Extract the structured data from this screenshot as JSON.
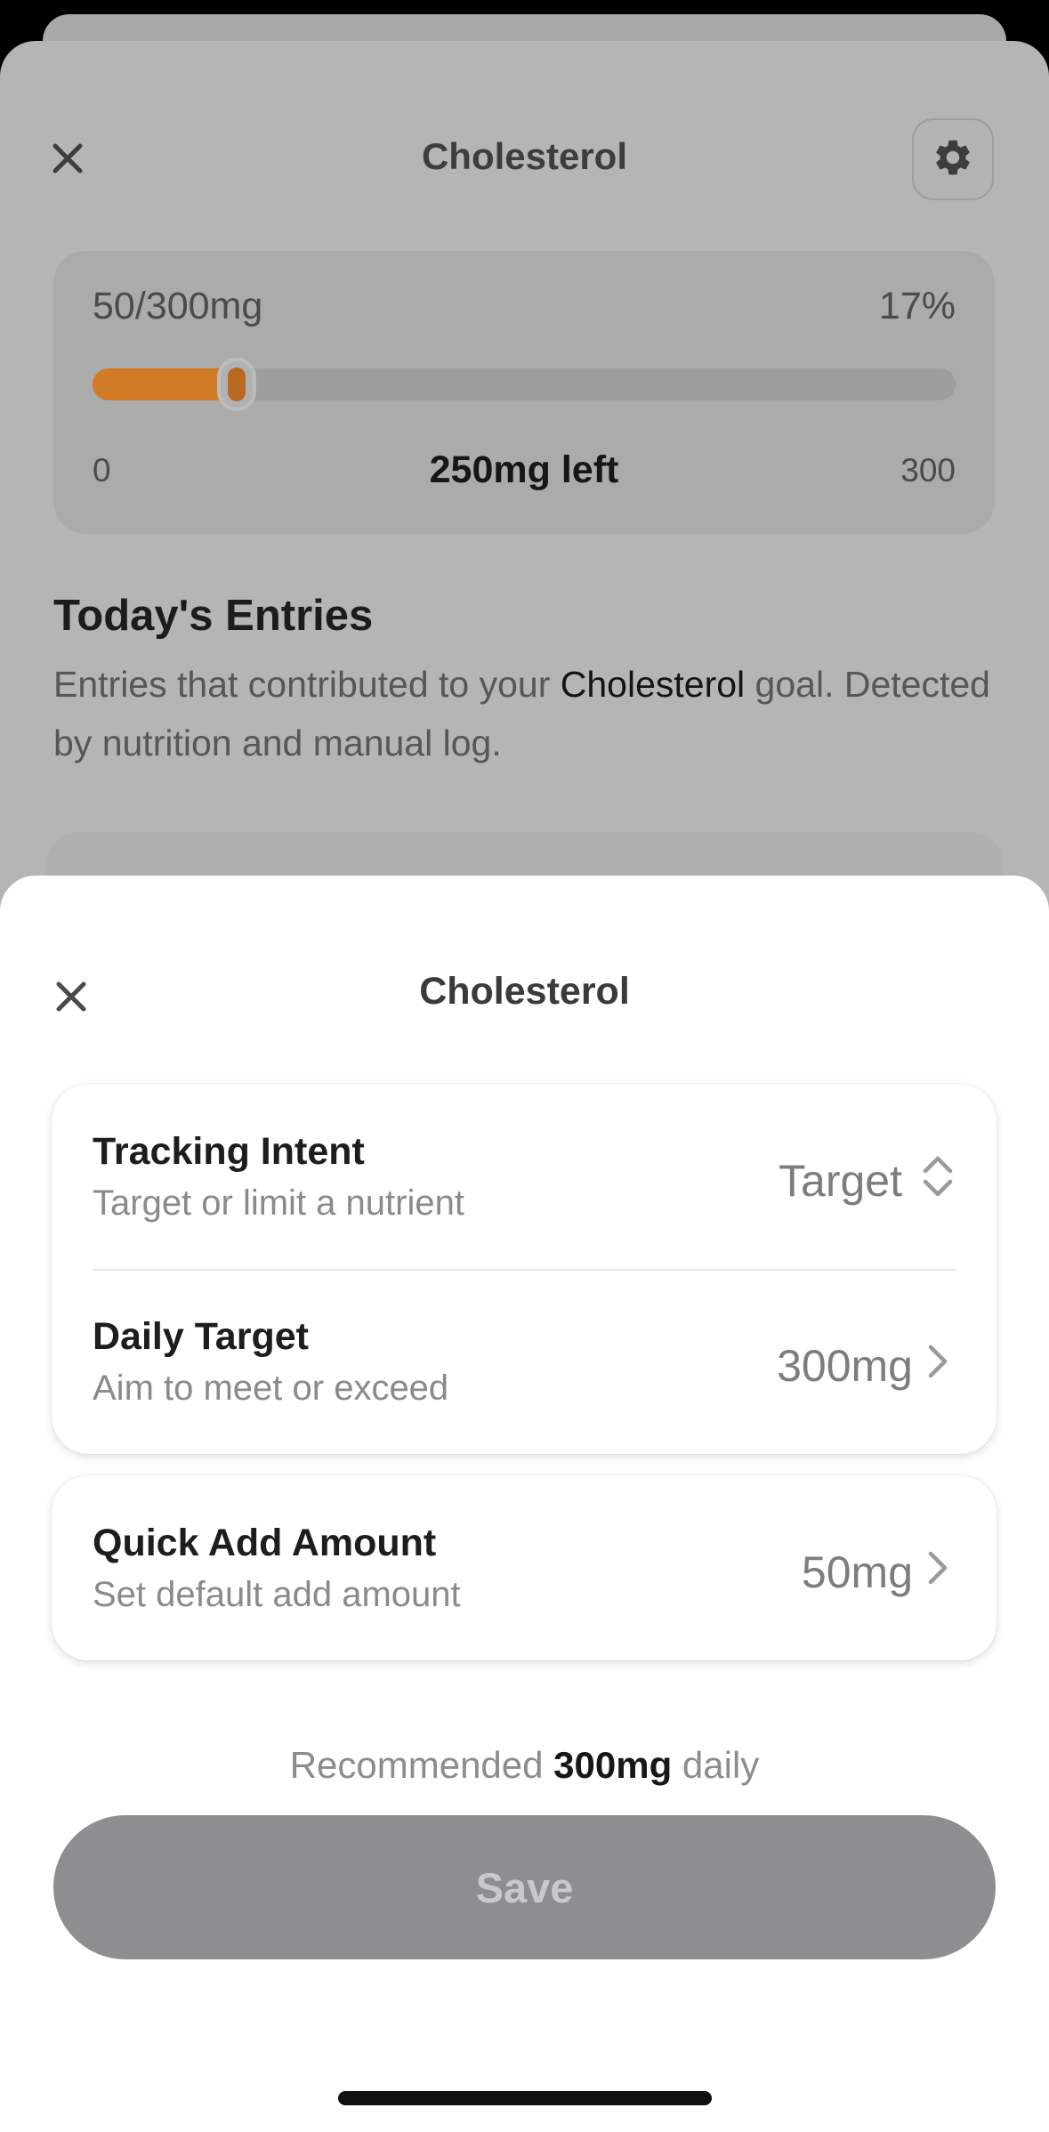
{
  "background_sheet": {
    "title": "Cholesterol",
    "progress": {
      "amount_text": "50/300mg",
      "percent_text": "17%",
      "fraction": 0.167,
      "min_label": "0",
      "remaining_text": "250mg left",
      "max_label": "300",
      "fill_color": "#d17b26"
    },
    "entries": {
      "title": "Today's Entries",
      "desc_before": "Entries that contributed to your ",
      "desc_highlight": "Cholesterol",
      "desc_after": " goal. Detected by nutrition and manual log."
    }
  },
  "modal": {
    "title": "Cholesterol",
    "tracking_intent": {
      "title": "Tracking Intent",
      "subtitle": "Target or limit a nutrient",
      "value": "Target"
    },
    "daily_target": {
      "title": "Daily Target",
      "subtitle": "Aim to meet or exceed",
      "value": "300mg"
    },
    "quick_add": {
      "title": "Quick Add Amount",
      "subtitle": "Set default add amount",
      "value": "50mg"
    },
    "recommendation": {
      "prefix": "Recommended ",
      "value": "300mg",
      "suffix": " daily"
    },
    "save_label": "Save"
  },
  "icons": {
    "close": "close-icon",
    "settings": "gear-icon",
    "updown": "chevron-up-down-icon",
    "right": "chevron-right-icon"
  }
}
